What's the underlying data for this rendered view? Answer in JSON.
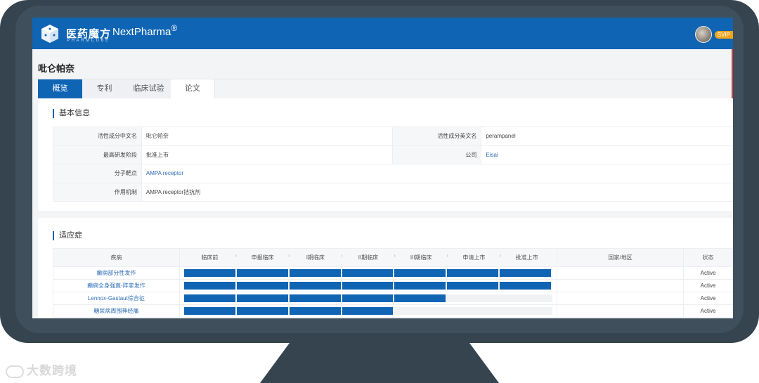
{
  "header": {
    "brand_cn": "医药魔方",
    "brand_en": "NextPharma",
    "brand_reg": "®",
    "brand_sub": "PHARMCUBE",
    "badge": "SVIP",
    "bar_color": "#0f64b4"
  },
  "drug": {
    "title": "吡仑帕奈"
  },
  "tabs": [
    {
      "label": "概览",
      "active": true
    },
    {
      "label": "专利",
      "active": false
    },
    {
      "label": "临床试验",
      "active": false
    },
    {
      "label": "论文",
      "active": false
    }
  ],
  "basic": {
    "section_title": "基本信息",
    "rows": [
      {
        "k1": "活性成分中文名",
        "v1": "吡仑帕奈",
        "k2": "活性成分英文名",
        "v2": "perampanel"
      },
      {
        "k1": "最高研发阶段",
        "v1": "批准上市",
        "k2": "公司",
        "v2": "Eisai"
      },
      {
        "k1": "分子靶点",
        "v1": "AMPA receptor"
      },
      {
        "k1": "作用机制",
        "v1": "AMPA receptor拮抗剂"
      }
    ]
  },
  "indications": {
    "section_title": "适应症",
    "columns": {
      "disease": "疾病",
      "region": "国家/地区",
      "status": "状态"
    },
    "stages": [
      "临床前",
      "申报临床",
      "I期临床",
      "II期临床",
      "III期临床",
      "申请上市",
      "批准上市"
    ],
    "rows": [
      {
        "disease": "癫痫部分性发作",
        "progress_stages": 7,
        "region": "",
        "status": "Active"
      },
      {
        "disease": "癫痫全身强直-阵挛发作",
        "progress_stages": 7,
        "region": "",
        "status": "Active"
      },
      {
        "disease": "Lennox-Gastaut综合征",
        "progress_stages": 5,
        "region": "",
        "status": "Active"
      },
      {
        "disease": "糖尿病周围神经痛",
        "progress_stages": 4,
        "region": "",
        "status": "Active"
      }
    ]
  },
  "watermark": {
    "text": "大数跨境"
  }
}
